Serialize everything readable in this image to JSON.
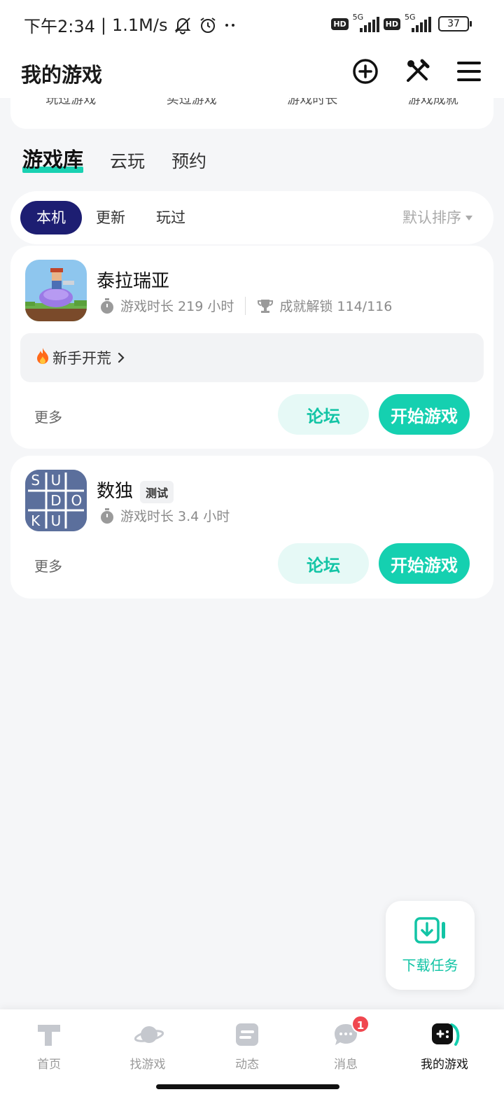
{
  "status_bar": {
    "time": "下午2:34",
    "network_speed": "1.1M/s",
    "sim1_tag": "HD",
    "sim1_network": "5G",
    "sim2_tag": "HD",
    "sim2_network": "5G",
    "battery": "37"
  },
  "header": {
    "title": "我的游戏",
    "icons": [
      "add-circle-icon",
      "tools-icon",
      "menu-icon"
    ]
  },
  "stats": {
    "items": [
      "玩过游戏",
      "买过游戏",
      "游戏时长",
      "游戏成就"
    ]
  },
  "main_tabs": [
    {
      "label": "游戏库",
      "active": true
    },
    {
      "label": "云玩",
      "active": false
    },
    {
      "label": "预约",
      "active": false
    }
  ],
  "filters": {
    "chips": [
      {
        "label": "本机",
        "active": true
      },
      {
        "label": "更新",
        "active": false
      },
      {
        "label": "玩过",
        "active": false
      }
    ],
    "sort_label": "默认排序"
  },
  "games": [
    {
      "name": "泰拉瑞亚",
      "badge": "",
      "playtime": "游戏时长 219 小时",
      "achievements": "成就解锁 114/116",
      "tip": "新手开荒",
      "more": "更多",
      "forum": "论坛",
      "start": "开始游戏"
    },
    {
      "name": "数独",
      "badge": "测试",
      "playtime": "游戏时长 3.4 小时",
      "more": "更多",
      "forum": "论坛",
      "start": "开始游戏",
      "icon_letters": [
        "S",
        "U",
        "D",
        "O",
        "K",
        "U"
      ]
    }
  ],
  "download_fab": {
    "label": "下载任务"
  },
  "bottom_nav": [
    {
      "label": "首页",
      "icon": "home-icon",
      "active": false
    },
    {
      "label": "找游戏",
      "icon": "planet-icon",
      "active": false
    },
    {
      "label": "动态",
      "icon": "feed-icon",
      "active": false
    },
    {
      "label": "消息",
      "icon": "message-icon",
      "active": false,
      "badge": "1"
    },
    {
      "label": "我的游戏",
      "icon": "gamepad-icon",
      "active": true
    }
  ],
  "colors": {
    "accent": "#15d0b0",
    "chip_active": "#1d1e72",
    "badge_red": "#f0474f"
  }
}
